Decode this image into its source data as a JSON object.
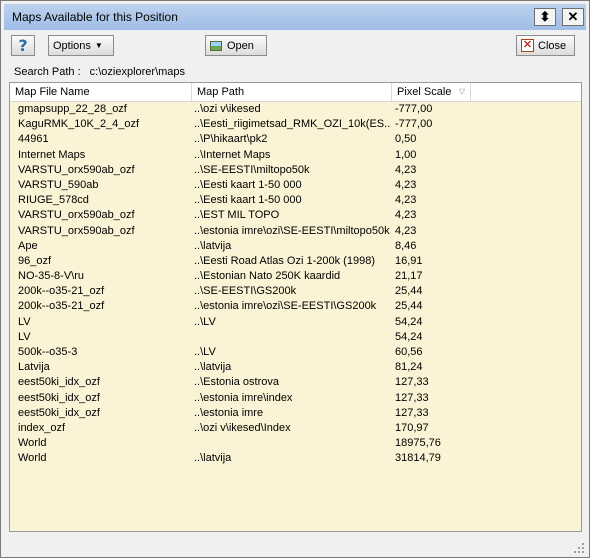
{
  "window": {
    "title": "Maps Available for this Position"
  },
  "titlebar": {
    "help_glyph": "⬍",
    "close_glyph": "✕"
  },
  "toolbar": {
    "help_label": "?",
    "options_label": "Options",
    "open_label": "Open",
    "close_label": "Close"
  },
  "search": {
    "label": "Search Path :",
    "value": "c:\\oziexplorer\\maps"
  },
  "table": {
    "headers": [
      "Map File Name",
      "Map Path",
      "Pixel Scale",
      ""
    ],
    "rows": [
      [
        "gmapsupp_22_28_ozf",
        "..\\ozi v\\ikesed",
        "-777,00"
      ],
      [
        "KaguRMK_10K_2_4_ozf",
        "..\\Eesti_riigimetsad_RMK_OZI_10k(ES...",
        "-777,00"
      ],
      [
        "44961",
        "..\\P\\hikaart\\pk2",
        "0,50"
      ],
      [
        "Internet Maps",
        "..\\Internet Maps",
        "1,00"
      ],
      [
        "VARSTU_orx590ab_ozf",
        "..\\SE-EESTI\\miltopo50k",
        "4,23"
      ],
      [
        "VARSTU_590ab",
        "..\\Eesti kaart 1-50 000",
        "4,23"
      ],
      [
        "RIUGE_578cd",
        "..\\Eesti kaart 1-50 000",
        "4,23"
      ],
      [
        "VARSTU_orx590ab_ozf",
        "..\\EST MIL TOPO",
        "4,23"
      ],
      [
        "VARSTU_orx590ab_ozf",
        "..\\estonia imre\\ozi\\SE-EESTI\\miltopo50k",
        "4,23"
      ],
      [
        "Ape",
        "..\\latvija",
        "8,46"
      ],
      [
        "96_ozf",
        "..\\Eesti Road Atlas Ozi 1-200k (1998)",
        "16,91"
      ],
      [
        "NO-35-8-V\\ru",
        "..\\Estonian Nato 250K kaardid",
        "21,17"
      ],
      [
        "200k--o35-21_ozf",
        "..\\SE-EESTI\\GS200k",
        "25,44"
      ],
      [
        "200k--o35-21_ozf",
        "..\\estonia imre\\ozi\\SE-EESTI\\GS200k",
        "25,44"
      ],
      [
        "LV",
        "..\\LV",
        "54,24"
      ],
      [
        "LV",
        "",
        "54,24"
      ],
      [
        "500k--o35-3",
        "..\\LV",
        "60,56"
      ],
      [
        "Latvija",
        "..\\latvija",
        "81,24"
      ],
      [
        "eest50ki_idx_ozf",
        "..\\Estonia ostrova",
        "127,33"
      ],
      [
        "eest50ki_idx_ozf",
        "..\\estonia imre\\index",
        "127,33"
      ],
      [
        "eest50ki_idx_ozf",
        "..\\estonia imre",
        "127,33"
      ],
      [
        "index_ozf",
        "..\\ozi v\\ikesed\\Index",
        "170,97"
      ],
      [
        "World",
        "",
        "18975,76"
      ],
      [
        "World",
        "..\\latvija",
        "31814,79"
      ]
    ]
  }
}
